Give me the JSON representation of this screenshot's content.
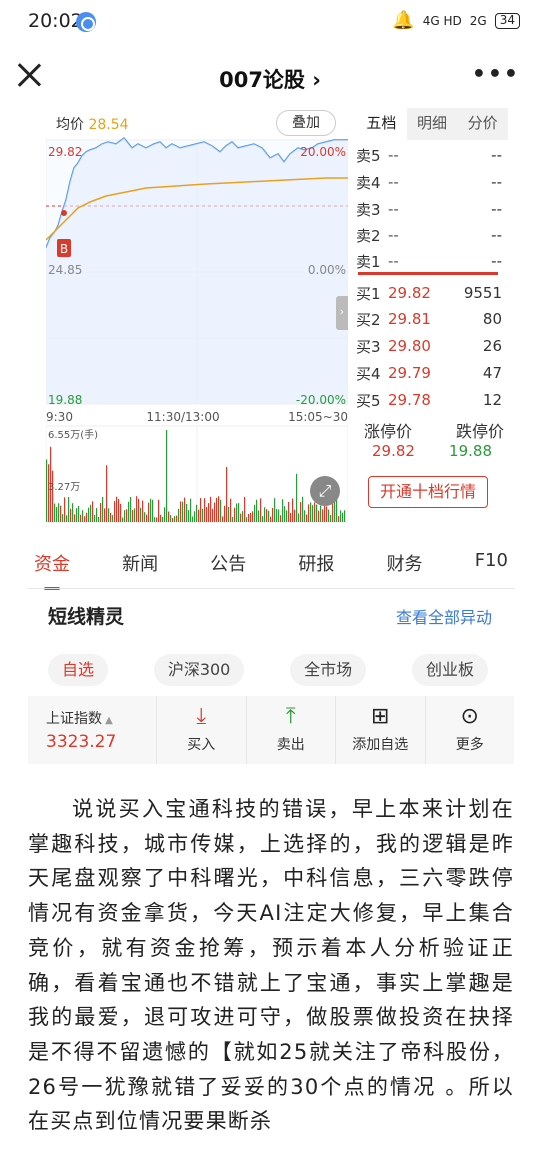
{
  "status_bar": {
    "time": "20:02",
    "net1": "4G HD",
    "net2": "2G",
    "battery": "34"
  },
  "nav": {
    "title": "007论股 ›"
  },
  "chart": {
    "avg_label": "均价",
    "avg_value": "28.54",
    "overlay_button": "叠加",
    "price_high": "29.82",
    "price_base": "24.85",
    "price_low": "19.88",
    "pct_high": "20.00%",
    "pct_base": "0.00%",
    "pct_low": "-20.00%",
    "t_start": "9:30",
    "t_mid": "11:30/13:00",
    "t_end": "15:05~30",
    "vol_max": "6.55万(手)",
    "vol_mid": "3.27万",
    "buy_marker": "B",
    "colors": {
      "up": "#d93a2b",
      "down": "#2a9a3a",
      "line": "#4a90e2",
      "avg": "#e8a21a"
    }
  },
  "order_book": {
    "tabs": [
      "五档",
      "明细",
      "分价"
    ],
    "sells": [
      {
        "label": "卖5",
        "price": "--",
        "qty": "--"
      },
      {
        "label": "卖4",
        "price": "--",
        "qty": "--"
      },
      {
        "label": "卖3",
        "price": "--",
        "qty": "--"
      },
      {
        "label": "卖2",
        "price": "--",
        "qty": "--"
      },
      {
        "label": "卖1",
        "price": "--",
        "qty": "--"
      }
    ],
    "buys": [
      {
        "label": "买1",
        "price": "29.82",
        "qty": "9551"
      },
      {
        "label": "买2",
        "price": "29.81",
        "qty": "80"
      },
      {
        "label": "买3",
        "price": "29.80",
        "qty": "26"
      },
      {
        "label": "买4",
        "price": "29.79",
        "qty": "47"
      },
      {
        "label": "买5",
        "price": "29.78",
        "qty": "12"
      }
    ],
    "limit_up_label": "涨停价",
    "limit_down_label": "跌停价",
    "limit_up": "29.82",
    "limit_down": "19.88",
    "open_ten": "开通十档行情"
  },
  "fin_tabs": [
    "资金",
    "新闻",
    "公告",
    "研报",
    "财务",
    "F10"
  ],
  "section": {
    "title": "短线精灵",
    "link": "查看全部异动"
  },
  "filters": [
    "自选",
    "沪深300",
    "全市场",
    "创业板"
  ],
  "toolbar": {
    "index_name": "上证指数",
    "index_value": "3323.27",
    "buy": "买入",
    "sell": "卖出",
    "add": "添加自选",
    "more": "更多"
  },
  "article": {
    "text": "说说买入宝通科技的错误，早上本来计划在掌趣科技，城市传媒，上选择的，我的逻辑是昨天尾盘观察了中科曙光，中科信息，三六零跌停情况有资金拿货，今天AI注定大修复，早上集合竞价，就有资金抢筹，预示着本人分析验证正确，看着宝通也不错就上了宝通，事实上掌趣是我的最爱，退可攻进可守，做股票做投资在抉择是不得不留遗憾的【就如25就关注了帝科股份，26号一犹豫就错了妥妥的30个点的情况 。所以在买点到位情况要果断杀"
  }
}
